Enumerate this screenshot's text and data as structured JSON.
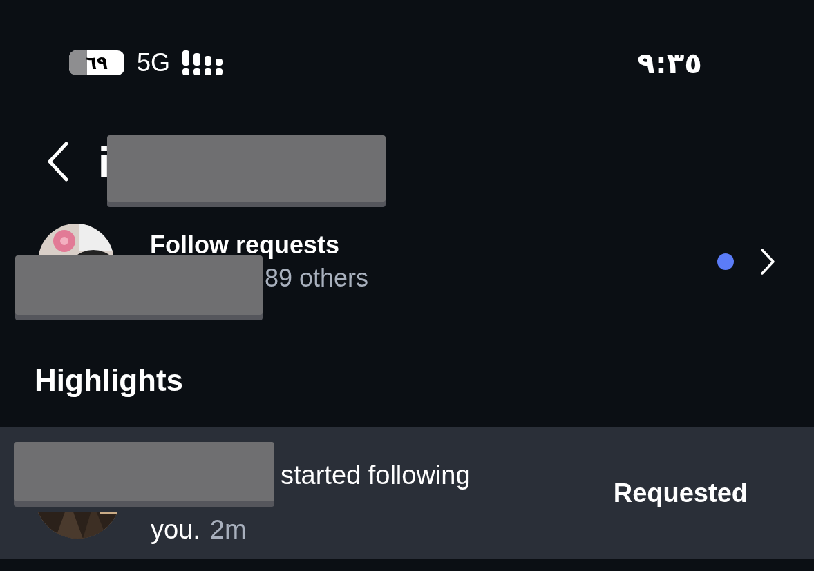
{
  "status_bar": {
    "battery": "٦٩",
    "network": "5G",
    "time": "٩:٣٥"
  },
  "header": {
    "title": "i"
  },
  "follow_requests": {
    "title": "Follow requests",
    "subtitle": "89 others",
    "unread": true
  },
  "section_title": "Highlights",
  "highlights": [
    {
      "lines": [
        "started following",
        "you."
      ],
      "time": "2m",
      "action": "Requested"
    }
  ]
}
